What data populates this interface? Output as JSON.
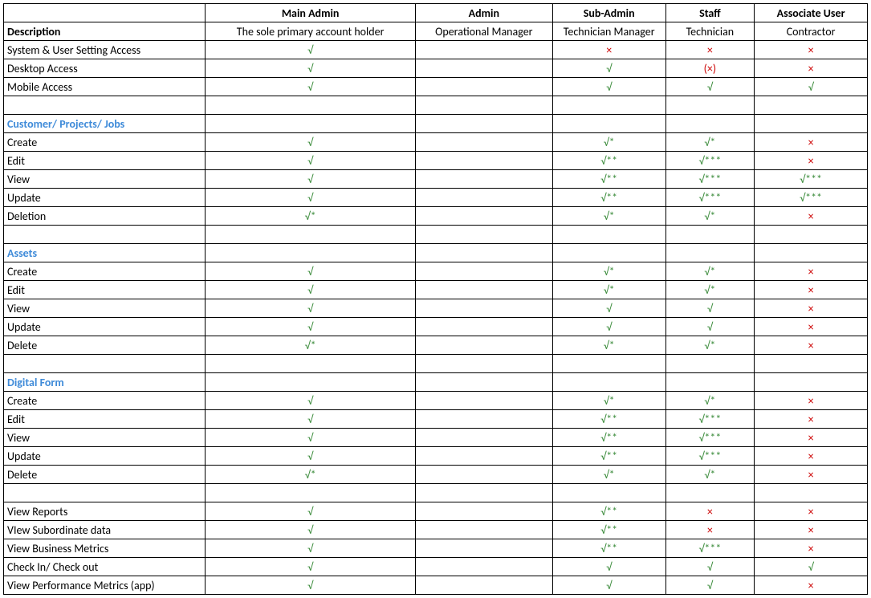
{
  "chart_data": {
    "type": "table",
    "title": "",
    "columns": [
      "Description",
      "Main Admin",
      "Admin",
      "Sub-Admin",
      "Staff",
      "Associate User"
    ],
    "sub_header": [
      "",
      "The sole primary account holder",
      "Operational Manager",
      "Technician Manager",
      "Technician",
      "Contractor"
    ],
    "sections": [
      {
        "name": null,
        "rows": [
          {
            "label": "System & User Setting Access",
            "values": [
              "√",
              "",
              "×",
              "×",
              "×"
            ]
          },
          {
            "label": "Desktop Access",
            "values": [
              "√",
              "",
              "√",
              "(×)",
              "×"
            ]
          },
          {
            "label": "Mobile Access",
            "values": [
              "√",
              "",
              "√",
              "√",
              "√"
            ]
          }
        ]
      },
      {
        "name": "Customer/ Projects/ Jobs",
        "rows": [
          {
            "label": "Create",
            "values": [
              "√",
              "",
              "√*",
              "√*",
              "×"
            ]
          },
          {
            "label": "Edit",
            "values": [
              "√",
              "",
              "√**",
              "√***",
              "×"
            ]
          },
          {
            "label": "View",
            "values": [
              "√",
              "",
              "√**",
              "√***",
              "√***"
            ]
          },
          {
            "label": "Update",
            "values": [
              "√",
              "",
              "√**",
              "√***",
              "√***"
            ]
          },
          {
            "label": "Deletion",
            "values": [
              "√*",
              "",
              "√*",
              "√*",
              "×"
            ]
          }
        ]
      },
      {
        "name": "Assets",
        "rows": [
          {
            "label": "Create",
            "values": [
              "√",
              "",
              "√*",
              "√*",
              "×"
            ]
          },
          {
            "label": "Edit",
            "values": [
              "√",
              "",
              "√*",
              "√*",
              "×"
            ]
          },
          {
            "label": "View",
            "values": [
              "√",
              "",
              "√",
              "√",
              "×"
            ]
          },
          {
            "label": "Update",
            "values": [
              "√",
              "",
              "√",
              "√",
              "×"
            ]
          },
          {
            "label": "Delete",
            "values": [
              "√*",
              "",
              "√*",
              "√*",
              "×"
            ]
          }
        ]
      },
      {
        "name": "Digital Form",
        "rows": [
          {
            "label": "Create",
            "values": [
              "√",
              "",
              "√*",
              "√*",
              "×"
            ]
          },
          {
            "label": "Edit",
            "values": [
              "√",
              "",
              "√**",
              "√***",
              "×"
            ]
          },
          {
            "label": "View",
            "values": [
              "√",
              "",
              "√**",
              "√***",
              "×"
            ]
          },
          {
            "label": "Update",
            "values": [
              "√",
              "",
              "√**",
              "√***",
              "×"
            ]
          },
          {
            "label": "Delete",
            "values": [
              "√*",
              "",
              "√*",
              "√*",
              "×"
            ]
          }
        ]
      },
      {
        "name": null,
        "rows": [
          {
            "label": "View Reports",
            "values": [
              "√",
              "",
              "√**",
              "×",
              "×"
            ]
          },
          {
            "label": "VIew Subordinate data",
            "values": [
              "√",
              "",
              "√**",
              "×",
              "×"
            ]
          },
          {
            "label": "View Business Metrics",
            "values": [
              "√",
              "",
              "√**",
              "√***",
              "×"
            ]
          },
          {
            "label": "Check In/ Check out",
            "values": [
              "√",
              "",
              "√",
              "√",
              "√"
            ]
          },
          {
            "label": "View Performance Metrics (app)",
            "values": [
              "√",
              "",
              "√",
              "√",
              "×"
            ]
          }
        ]
      }
    ]
  }
}
